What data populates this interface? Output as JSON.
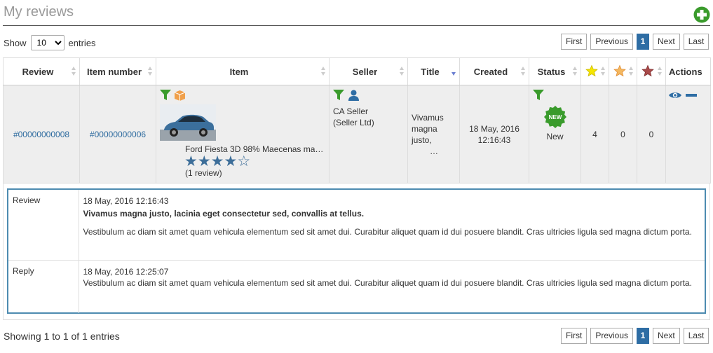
{
  "page": {
    "title": "My reviews"
  },
  "length": {
    "show_label": "Show",
    "value": "10",
    "entries_label": "entries"
  },
  "pager": {
    "first": "First",
    "previous": "Previous",
    "current": "1",
    "next": "Next",
    "last": "Last"
  },
  "columns": {
    "review": "Review",
    "item_number": "Item number",
    "item": "Item",
    "seller": "Seller",
    "title": "Title",
    "created": "Created",
    "status": "Status",
    "actions": "Actions"
  },
  "row": {
    "review_id": "#00000000008",
    "item_number": "#00000000006",
    "item_name": "Ford Fiesta 3D 98% Maecenas ma…",
    "item_rating": 4,
    "item_reviews": "(1 review)",
    "seller_name": "CA Seller",
    "seller_company": "(Seller Ltd)",
    "title_line1": "Vivamus",
    "title_line2": "magna",
    "title_line3": "justo,",
    "title_line4": "…",
    "created_date": "18 May, 2016",
    "created_time": "12:16:43",
    "status_text": "New",
    "status_badge": "NEW",
    "count_positive": "4",
    "count_neutral": "0",
    "count_negative": "0"
  },
  "detail": {
    "review_label": "Review",
    "review_date": "18 May, 2016 12:16:43",
    "review_title": "Vivamus magna justo, lacinia eget consectetur sed, convallis at tellus.",
    "review_body": "Vestibulum ac diam sit amet quam vehicula elementum sed sit amet dui. Curabitur aliquet quam id dui posuere blandit. Cras ultricies ligula sed magna dictum porta.",
    "reply_label": "Reply",
    "reply_date": "18 May, 2016 12:25:07",
    "reply_body": "Vestibulum ac diam sit amet quam vehicula elementum sed sit amet dui. Curabitur aliquet quam id dui posuere blandit. Cras ultricies ligula sed magna dictum porta."
  },
  "footer": {
    "info": "Showing 1 to 1 of 1 entries"
  },
  "colors": {
    "link": "#2c6a9e",
    "accent": "#2e6da4",
    "green": "#3a9b2c",
    "detail_border": "#4d8bb0"
  },
  "icons": [
    "add-icon",
    "filter-icon",
    "box-icon",
    "user-icon",
    "eye-icon",
    "minus-icon",
    "star-yellow-icon",
    "star-orange-icon",
    "star-red-icon"
  ]
}
